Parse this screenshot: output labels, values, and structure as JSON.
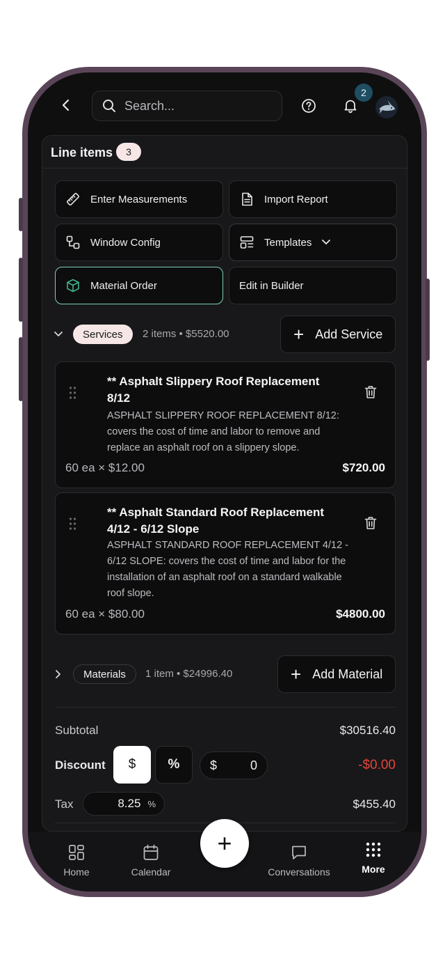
{
  "topbar": {
    "search_placeholder": "Search...",
    "notification_count": "2"
  },
  "line_items": {
    "title": "Line items",
    "count": "3"
  },
  "actions": [
    {
      "label": "Enter Measurements",
      "icon": "ruler-icon"
    },
    {
      "label": "Import Report",
      "icon": "document-icon"
    },
    {
      "label": "Window Config",
      "icon": "window-config-icon"
    },
    {
      "label": "Templates",
      "icon": "layout-icon"
    },
    {
      "label": "Material Order",
      "icon": "box-icon"
    },
    {
      "label": "Edit in Builder",
      "icon": ""
    }
  ],
  "services": {
    "label": "Services",
    "meta": "2 items • $5520.00",
    "add_label": "Add Service",
    "items": [
      {
        "title": "** Asphalt Slippery Roof Replacement 8/12",
        "description": "ASPHALT SLIPPERY ROOF REPLACEMENT 8/12: covers the cost of time and labor to remove and replace an asphalt roof on a slippery slope.",
        "quantity": "60 ea × $12.00",
        "total": "$720.00"
      },
      {
        "title": "** Asphalt Standard Roof Replacement 4/12 - 6/12 Slope",
        "description": "ASPHALT STANDARD ROOF REPLACEMENT 4/12 - 6/12 SLOPE: covers the cost of time and labor for the installation of an asphalt roof on a standard walkable roof slope.",
        "quantity": "60 ea × $80.00",
        "total": "$4800.00"
      }
    ]
  },
  "materials": {
    "label": "Materials",
    "meta": "1 item • $24996.40",
    "add_label": "Add Material"
  },
  "summary": {
    "subtotal_label": "Subtotal",
    "subtotal_value": "$30516.40",
    "discount_label": "Discount",
    "discount_dollar": "$",
    "discount_percent": "%",
    "discount_input_prefix": "$",
    "discount_input_value": "0",
    "discount_value": "-$0.00",
    "tax_label": "Tax",
    "tax_input_value": "8.25",
    "tax_input_unit": "%",
    "tax_value": "$455.40"
  },
  "bottom_nav": {
    "home": "Home",
    "calendar": "Calendar",
    "fab": "+",
    "conversations": "Conversations",
    "more": "More"
  },
  "colors": {
    "accent_selected": "#7fd1b9",
    "discount_red": "#e2453d",
    "badge_bg": "#f6e7e6"
  }
}
